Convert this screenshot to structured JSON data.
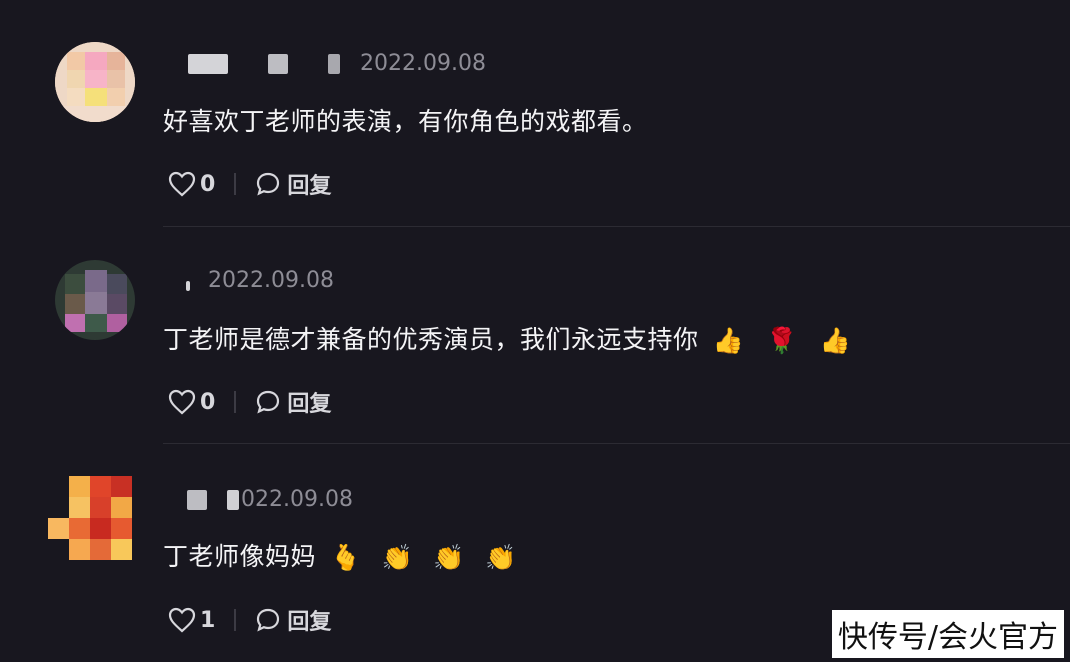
{
  "comments": [
    {
      "date": "2022.09.08",
      "text": "好喜欢丁老师的表演，有你角色的戏都看。",
      "likes": "0",
      "reply_label": "回复",
      "emojis": []
    },
    {
      "date": "2022.09.08",
      "text": "丁老师是德才兼备的优秀演员，我们永远支持你",
      "likes": "0",
      "reply_label": "回复",
      "emojis": [
        "👍",
        "🌹",
        "👍"
      ]
    },
    {
      "date": "022.09.08",
      "text": "丁老师像妈妈",
      "likes": "1",
      "reply_label": "回复",
      "emojis": [
        "🫰",
        "👏",
        "👏",
        "👏"
      ]
    }
  ],
  "watermark": "快传号/会火官方",
  "colors": {
    "background": "#18171f",
    "meta": "#8e8d96",
    "text": "#f4f4f6",
    "divider": "#2c2b33"
  }
}
